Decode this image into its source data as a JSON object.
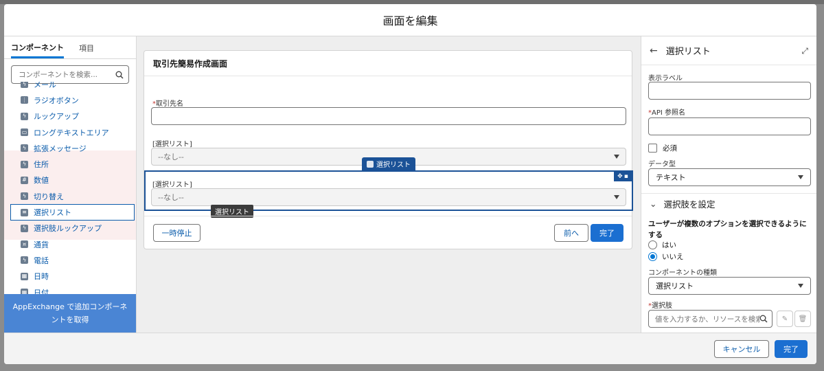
{
  "modal": {
    "title": "画面を編集"
  },
  "left": {
    "tabs": [
      "コンポーネント",
      "項目"
    ],
    "search_placeholder": "コンポーネントを検索...",
    "items": [
      {
        "label": "メール",
        "icon": "lightning-icon"
      },
      {
        "label": "ラジオボタン",
        "icon": "radio-group-icon"
      },
      {
        "label": "ルックアップ",
        "icon": "lightning-icon"
      },
      {
        "label": "ロングテキストエリア",
        "icon": "textarea-icon"
      },
      {
        "label": "拡張メッセージ",
        "icon": "lightning-icon"
      },
      {
        "label": "住所",
        "icon": "lightning-icon"
      },
      {
        "label": "数値",
        "icon": "number-icon"
      },
      {
        "label": "切り替え",
        "icon": "lightning-icon"
      },
      {
        "label": "選択リスト",
        "icon": "picklist-icon"
      },
      {
        "label": "選択肢ルックアップ",
        "icon": "lightning-icon"
      },
      {
        "label": "通貨",
        "icon": "currency-icon"
      },
      {
        "label": "電話",
        "icon": "lightning-icon"
      },
      {
        "label": "日時",
        "icon": "calendar-icon"
      },
      {
        "label": "日付",
        "icon": "calendar-icon"
      }
    ],
    "appexchange": "AppExchange で追加コンポーネントを取得"
  },
  "canvas": {
    "title": "取引先簡易作成画面",
    "field1_label": "取引先名",
    "field2_label": "[選択リスト]",
    "field2_value": "--なし--",
    "field3_label": "[選択リスト]",
    "field3_value": "--なし--",
    "selected_badge": "選択リスト",
    "tooltip": "選択リスト",
    "pause_button": "一時停止",
    "prev_button": "前へ",
    "finish_button": "完了"
  },
  "right": {
    "title": "選択リスト",
    "display_label": "表示ラベル",
    "api_label": "API 参照名",
    "required_label": "必須",
    "data_type_label": "データ型",
    "data_type_value": "テキスト",
    "section_title": "選択肢を設定",
    "multi_question": "ユーザーが複数のオプションを選択できるようにする",
    "radio_yes": "はい",
    "radio_no": "いいえ",
    "component_type_label": "コンポーネントの種類",
    "component_type_value": "選択リスト",
    "choices_label": "選択肢",
    "choices_placeholder": "値を入力するか、リソースを検索..."
  },
  "footer": {
    "cancel": "キャンセル",
    "done": "完了"
  }
}
